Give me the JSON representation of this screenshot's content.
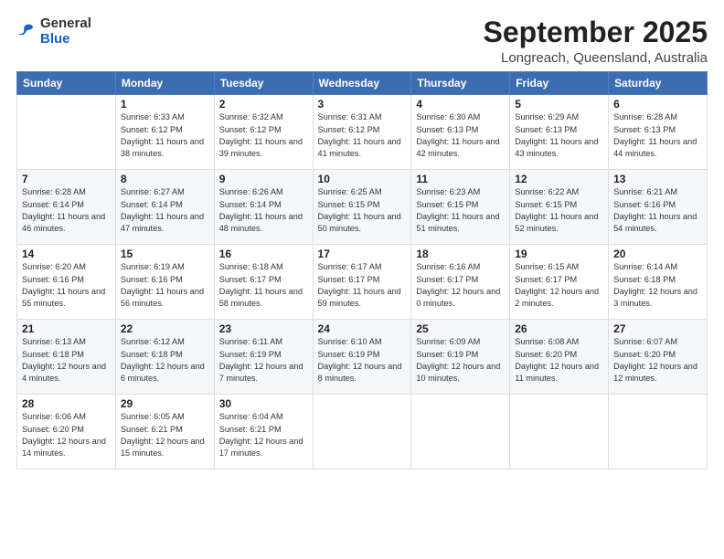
{
  "header": {
    "logo_general": "General",
    "logo_blue": "Blue",
    "month": "September 2025",
    "location": "Longreach, Queensland, Australia"
  },
  "weekdays": [
    "Sunday",
    "Monday",
    "Tuesday",
    "Wednesday",
    "Thursday",
    "Friday",
    "Saturday"
  ],
  "weeks": [
    [
      {
        "day": "",
        "info": ""
      },
      {
        "day": "1",
        "info": "Sunrise: 6:33 AM\nSunset: 6:12 PM\nDaylight: 11 hours\nand 38 minutes."
      },
      {
        "day": "2",
        "info": "Sunrise: 6:32 AM\nSunset: 6:12 PM\nDaylight: 11 hours\nand 39 minutes."
      },
      {
        "day": "3",
        "info": "Sunrise: 6:31 AM\nSunset: 6:12 PM\nDaylight: 11 hours\nand 41 minutes."
      },
      {
        "day": "4",
        "info": "Sunrise: 6:30 AM\nSunset: 6:13 PM\nDaylight: 11 hours\nand 42 minutes."
      },
      {
        "day": "5",
        "info": "Sunrise: 6:29 AM\nSunset: 6:13 PM\nDaylight: 11 hours\nand 43 minutes."
      },
      {
        "day": "6",
        "info": "Sunrise: 6:28 AM\nSunset: 6:13 PM\nDaylight: 11 hours\nand 44 minutes."
      }
    ],
    [
      {
        "day": "7",
        "info": "Sunrise: 6:28 AM\nSunset: 6:14 PM\nDaylight: 11 hours\nand 46 minutes."
      },
      {
        "day": "8",
        "info": "Sunrise: 6:27 AM\nSunset: 6:14 PM\nDaylight: 11 hours\nand 47 minutes."
      },
      {
        "day": "9",
        "info": "Sunrise: 6:26 AM\nSunset: 6:14 PM\nDaylight: 11 hours\nand 48 minutes."
      },
      {
        "day": "10",
        "info": "Sunrise: 6:25 AM\nSunset: 6:15 PM\nDaylight: 11 hours\nand 50 minutes."
      },
      {
        "day": "11",
        "info": "Sunrise: 6:23 AM\nSunset: 6:15 PM\nDaylight: 11 hours\nand 51 minutes."
      },
      {
        "day": "12",
        "info": "Sunrise: 6:22 AM\nSunset: 6:15 PM\nDaylight: 11 hours\nand 52 minutes."
      },
      {
        "day": "13",
        "info": "Sunrise: 6:21 AM\nSunset: 6:16 PM\nDaylight: 11 hours\nand 54 minutes."
      }
    ],
    [
      {
        "day": "14",
        "info": "Sunrise: 6:20 AM\nSunset: 6:16 PM\nDaylight: 11 hours\nand 55 minutes."
      },
      {
        "day": "15",
        "info": "Sunrise: 6:19 AM\nSunset: 6:16 PM\nDaylight: 11 hours\nand 56 minutes."
      },
      {
        "day": "16",
        "info": "Sunrise: 6:18 AM\nSunset: 6:17 PM\nDaylight: 11 hours\nand 58 minutes."
      },
      {
        "day": "17",
        "info": "Sunrise: 6:17 AM\nSunset: 6:17 PM\nDaylight: 11 hours\nand 59 minutes."
      },
      {
        "day": "18",
        "info": "Sunrise: 6:16 AM\nSunset: 6:17 PM\nDaylight: 12 hours\nand 0 minutes."
      },
      {
        "day": "19",
        "info": "Sunrise: 6:15 AM\nSunset: 6:17 PM\nDaylight: 12 hours\nand 2 minutes."
      },
      {
        "day": "20",
        "info": "Sunrise: 6:14 AM\nSunset: 6:18 PM\nDaylight: 12 hours\nand 3 minutes."
      }
    ],
    [
      {
        "day": "21",
        "info": "Sunrise: 6:13 AM\nSunset: 6:18 PM\nDaylight: 12 hours\nand 4 minutes."
      },
      {
        "day": "22",
        "info": "Sunrise: 6:12 AM\nSunset: 6:18 PM\nDaylight: 12 hours\nand 6 minutes."
      },
      {
        "day": "23",
        "info": "Sunrise: 6:11 AM\nSunset: 6:19 PM\nDaylight: 12 hours\nand 7 minutes."
      },
      {
        "day": "24",
        "info": "Sunrise: 6:10 AM\nSunset: 6:19 PM\nDaylight: 12 hours\nand 8 minutes."
      },
      {
        "day": "25",
        "info": "Sunrise: 6:09 AM\nSunset: 6:19 PM\nDaylight: 12 hours\nand 10 minutes."
      },
      {
        "day": "26",
        "info": "Sunrise: 6:08 AM\nSunset: 6:20 PM\nDaylight: 12 hours\nand 11 minutes."
      },
      {
        "day": "27",
        "info": "Sunrise: 6:07 AM\nSunset: 6:20 PM\nDaylight: 12 hours\nand 12 minutes."
      }
    ],
    [
      {
        "day": "28",
        "info": "Sunrise: 6:06 AM\nSunset: 6:20 PM\nDaylight: 12 hours\nand 14 minutes."
      },
      {
        "day": "29",
        "info": "Sunrise: 6:05 AM\nSunset: 6:21 PM\nDaylight: 12 hours\nand 15 minutes."
      },
      {
        "day": "30",
        "info": "Sunrise: 6:04 AM\nSunset: 6:21 PM\nDaylight: 12 hours\nand 17 minutes."
      },
      {
        "day": "",
        "info": ""
      },
      {
        "day": "",
        "info": ""
      },
      {
        "day": "",
        "info": ""
      },
      {
        "day": "",
        "info": ""
      }
    ]
  ]
}
